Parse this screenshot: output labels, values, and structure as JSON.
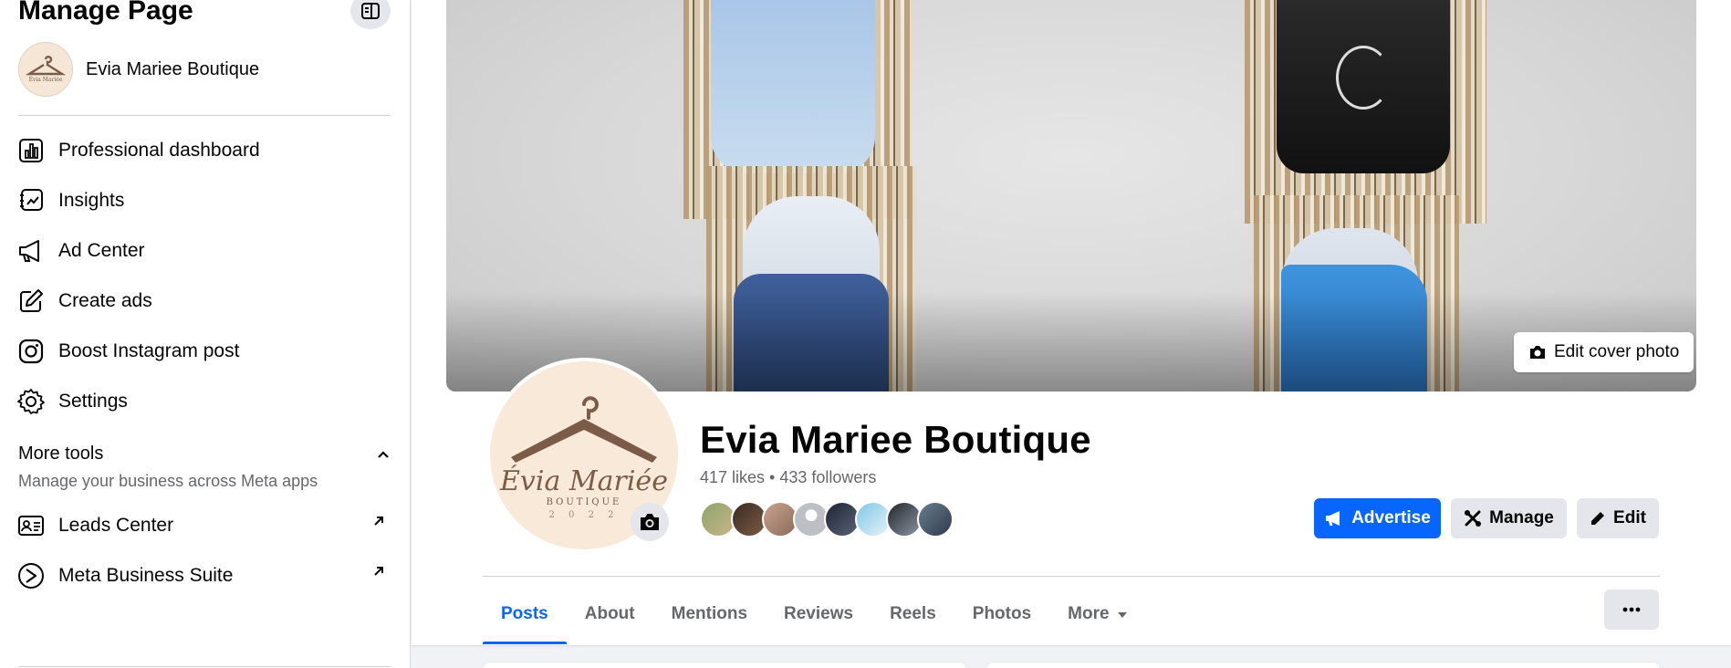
{
  "sidebar": {
    "title": "Manage Page",
    "page_name": "Evia Mariee Boutique",
    "items": [
      {
        "label": "Professional dashboard",
        "icon": "chart-icon"
      },
      {
        "label": "Insights",
        "icon": "insights-icon"
      },
      {
        "label": "Ad Center",
        "icon": "megaphone-icon"
      },
      {
        "label": "Create ads",
        "icon": "pencil-square-icon"
      },
      {
        "label": "Boost Instagram post",
        "icon": "instagram-icon"
      },
      {
        "label": "Settings",
        "icon": "gear-icon"
      }
    ],
    "more_tools": {
      "heading": "More tools",
      "subtitle": "Manage your business across Meta apps",
      "items": [
        {
          "label": "Leads Center",
          "icon": "id-card-icon"
        },
        {
          "label": "Meta Business Suite",
          "icon": "meta-business-suite-icon"
        }
      ]
    }
  },
  "profile": {
    "name": "Evia Mariee Boutique",
    "stats": "417 likes • 433 followers",
    "logo_text": "Évia Mariée",
    "logo_sub": "BOUTIQUE",
    "logo_year": "2 0 2 2"
  },
  "cover": {
    "edit_label": "Edit cover photo"
  },
  "actions": {
    "advertise": "Advertise",
    "manage": "Manage",
    "edit": "Edit"
  },
  "tabs": [
    {
      "label": "Posts",
      "active": true
    },
    {
      "label": "About"
    },
    {
      "label": "Mentions"
    },
    {
      "label": "Reviews"
    },
    {
      "label": "Reels"
    },
    {
      "label": "Photos"
    },
    {
      "label": "More"
    }
  ],
  "colors": {
    "accent": "#0866ff",
    "secondary_text": "#65676b",
    "button_gray": "#e4e6eb"
  }
}
